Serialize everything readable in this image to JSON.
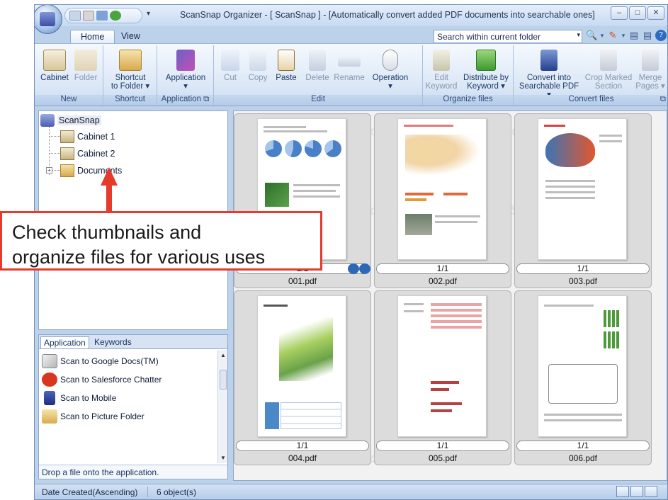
{
  "window": {
    "title": "ScanSnap Organizer - [ ScanSnap ] - [Automatically convert added PDF documents into searchable ones]",
    "controls": [
      "–",
      "□",
      "✕"
    ]
  },
  "tabs": {
    "home": "Home",
    "view": "View"
  },
  "search": {
    "value": "Search within current folder"
  },
  "ribbon": {
    "groups": {
      "new": "New",
      "shortcut": "Shortcut",
      "application": "Application",
      "edit": "Edit",
      "organize": "Organize files",
      "convert": "Convert files"
    },
    "buttons": {
      "cabinet": "Cabinet",
      "folder": "Folder",
      "shortcut1": "Shortcut",
      "shortcut2": "to Folder ▾",
      "application": "Application",
      "app_arrow": "▾",
      "cut": "Cut",
      "copy": "Copy",
      "paste": "Paste",
      "delete": "Delete",
      "rename": "Rename",
      "operation": "Operation",
      "op_arrow": "▾",
      "edit_kw1": "Edit",
      "edit_kw2": "Keyword",
      "dist1": "Distribute by",
      "dist2": "Keyword ▾",
      "convert1": "Convert into",
      "convert2": "Searchable PDF ▾",
      "crop1": "Crop Marked",
      "crop2": "Section",
      "merge1": "Merge",
      "merge2": "Pages ▾"
    }
  },
  "tree": {
    "root": "ScanSnap",
    "items": [
      "Cabinet 1",
      "Cabinet 2",
      "Documents"
    ],
    "expander": "+"
  },
  "app_panel": {
    "tabs": [
      "Application",
      "Keywords"
    ],
    "items": [
      "Scan to Google Docs(TM)",
      "Scan to Salesforce Chatter",
      "Scan to Mobile",
      "Scan to Picture Folder"
    ],
    "hint": "Drop a file onto the application."
  },
  "thumbnails": [
    {
      "pages": "1/1",
      "name": "001.pdf"
    },
    {
      "pages": "1/1",
      "name": "002.pdf"
    },
    {
      "pages": "1/1",
      "name": "003.pdf"
    },
    {
      "pages": "1/1",
      "name": "004.pdf"
    },
    {
      "pages": "1/1",
      "name": "005.pdf"
    },
    {
      "pages": "1/1",
      "name": "006.pdf"
    }
  ],
  "watermark": "ScanSnap",
  "status": {
    "sort": "Date Created(Ascending)",
    "count": "6 object(s)"
  },
  "callout": {
    "line1": "Check thumbnails and",
    "line2": "organize files for various uses"
  },
  "colors": {
    "accent": "#e53a2c",
    "ribbon": "#dbe7f6",
    "frame": "#bcd1ea"
  }
}
